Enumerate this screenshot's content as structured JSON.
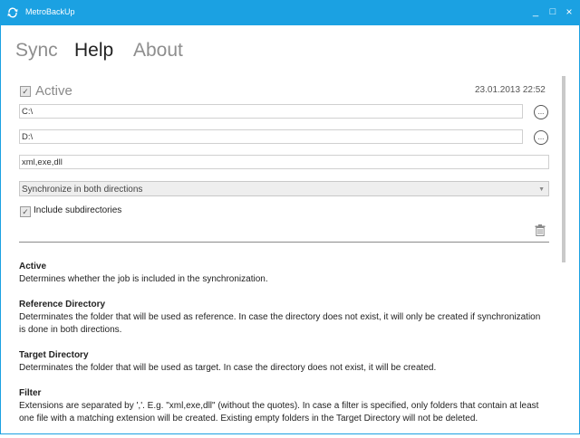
{
  "app": {
    "title": "MetroBackUp"
  },
  "window_controls": {
    "minimize": "_",
    "maximize": "□",
    "close": "×"
  },
  "tabs": [
    {
      "label": "Sync",
      "active": false
    },
    {
      "label": "Help",
      "active": true
    },
    {
      "label": "About",
      "active": false
    }
  ],
  "job": {
    "active_label": "Active",
    "active_checked": true,
    "timestamp": "23.01.2013 22:52",
    "reference_dir": "C:\\",
    "target_dir": "D:\\",
    "filter": "xml,exe,dll",
    "direction": "Synchronize in both directions",
    "include_subdirs_label": "Include subdirectories",
    "include_subdirs_checked": true,
    "browse_label": "..."
  },
  "help": [
    {
      "title": "Active",
      "text": "Determines whether the job is included in the synchronization."
    },
    {
      "title": "Reference Directory",
      "text": "Determinates the folder that will be used as reference. In case the directory does not exist, it will only be created if synchronization is done in both directions."
    },
    {
      "title": "Target Directory",
      "text": "Determinates the folder that will be used as target. In case the directory does not exist, it will be created."
    },
    {
      "title": "Filter",
      "text": "Extensions are separated by ','. E.g. \"xml,exe,dll\" (without the quotes). In case a filter is specified, only folders that contain at least one file with a matching extension will be created. Existing empty folders in the Target Directory will not be deleted."
    }
  ],
  "colors": {
    "accent": "#1ba1e2",
    "inactive_tab": "#8e8e8e"
  },
  "icons": [
    "sync-icon",
    "minimize-icon",
    "maximize-icon",
    "close-icon",
    "checkbox-icon",
    "browse-icon",
    "dropdown-arrow-icon",
    "trash-icon"
  ]
}
